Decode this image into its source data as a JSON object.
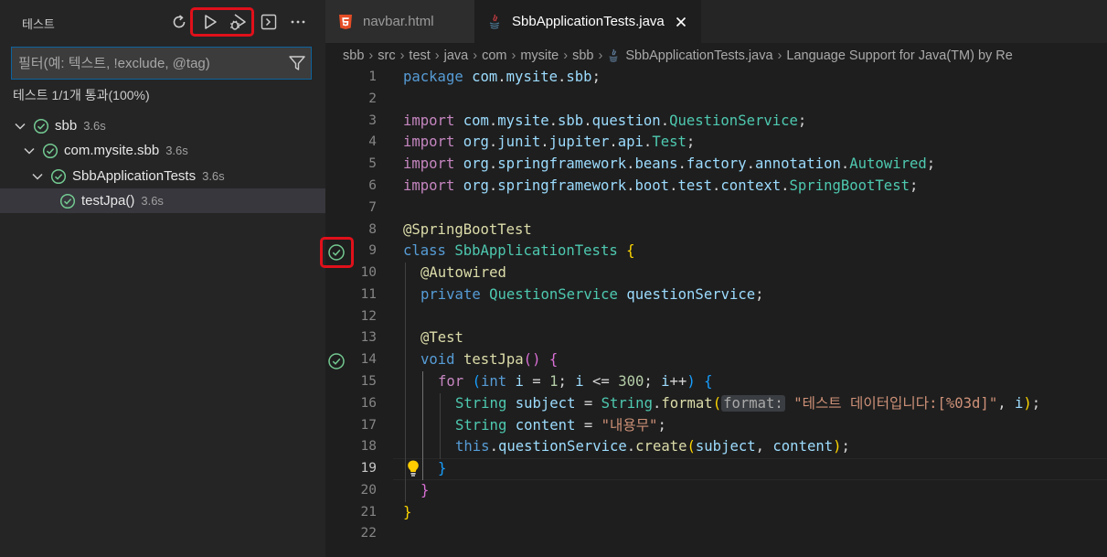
{
  "sidebar": {
    "title": "테스트",
    "filter_placeholder": "필터(예: 텍스트, !exclude, @tag)",
    "summary": "테스트 1/1개 통과(100%)",
    "tree": [
      {
        "label": "sbb",
        "duration": "3.6s"
      },
      {
        "label": "com.mysite.sbb",
        "duration": "3.6s"
      },
      {
        "label": "SbbApplicationTests",
        "duration": "3.6s"
      },
      {
        "label": "testJpa()",
        "duration": "3.6s"
      }
    ]
  },
  "tabs": [
    {
      "label": "navbar.html",
      "icon": "html5-icon"
    },
    {
      "label": "SbbApplicationTests.java",
      "icon": "java-icon"
    }
  ],
  "breadcrumb": [
    "sbb",
    "src",
    "test",
    "java",
    "com",
    "mysite",
    "sbb",
    "SbbApplicationTests.java",
    "Language Support for Java(TM) by Re"
  ],
  "editor": {
    "line_numbers": [
      "1",
      "2",
      "3",
      "4",
      "5",
      "6",
      "7",
      "8",
      "9",
      "10",
      "11",
      "12",
      "13",
      "14",
      "15",
      "16",
      "17",
      "18",
      "19",
      "20",
      "21",
      "22"
    ],
    "current_line": "19",
    "inlay_hint": "format:",
    "code": {
      "l1": [
        "package",
        " com",
        ".",
        "mysite",
        ".",
        "sbb",
        ";"
      ],
      "l3": [
        "import",
        " com",
        ".",
        "mysite",
        ".",
        "sbb",
        ".",
        "question",
        ".",
        "QuestionService",
        ";"
      ],
      "l4": [
        "import",
        " org",
        ".",
        "junit",
        ".",
        "jupiter",
        ".",
        "api",
        ".",
        "Test",
        ";"
      ],
      "l5": [
        "import",
        " org",
        ".",
        "springframework",
        ".",
        "beans",
        ".",
        "factory",
        ".",
        "annotation",
        ".",
        "Autowired",
        ";"
      ],
      "l6": [
        "import",
        " org",
        ".",
        "springframework",
        ".",
        "boot",
        ".",
        "test",
        ".",
        "context",
        ".",
        "SpringBootTest",
        ";"
      ],
      "l8": [
        "@SpringBootTest"
      ],
      "l9": [
        "class",
        " ",
        "SbbApplicationTests",
        " ",
        "{"
      ],
      "l10": [
        "@Autowired"
      ],
      "l11": [
        "private",
        " ",
        "QuestionService",
        " ",
        "questionService",
        ";"
      ],
      "l13": [
        "@Test"
      ],
      "l14": [
        "void",
        " ",
        "testJpa",
        "(",
        ")",
        " ",
        "{"
      ],
      "l15": [
        "for",
        " ",
        "(",
        "int",
        " ",
        "i",
        " = ",
        "1",
        "; ",
        "i",
        " <= ",
        "300",
        "; ",
        "i",
        "++",
        ")",
        " ",
        "{"
      ],
      "l16": [
        "String",
        " ",
        "subject",
        " = ",
        "String",
        ".",
        "format",
        "(",
        " ",
        "\"테스트 데이터입니다:[%03d]\"",
        ", ",
        "i",
        ")",
        ";"
      ],
      "l17": [
        "String",
        " ",
        "content",
        " = ",
        "\"내용무\"",
        ";"
      ],
      "l18": [
        "this",
        ".",
        "questionService",
        ".",
        "create",
        "(",
        "subject",
        ", ",
        "content",
        ")",
        ";"
      ],
      "l19": [
        "}"
      ],
      "l20": [
        "}"
      ],
      "l21": [
        "}"
      ]
    }
  }
}
